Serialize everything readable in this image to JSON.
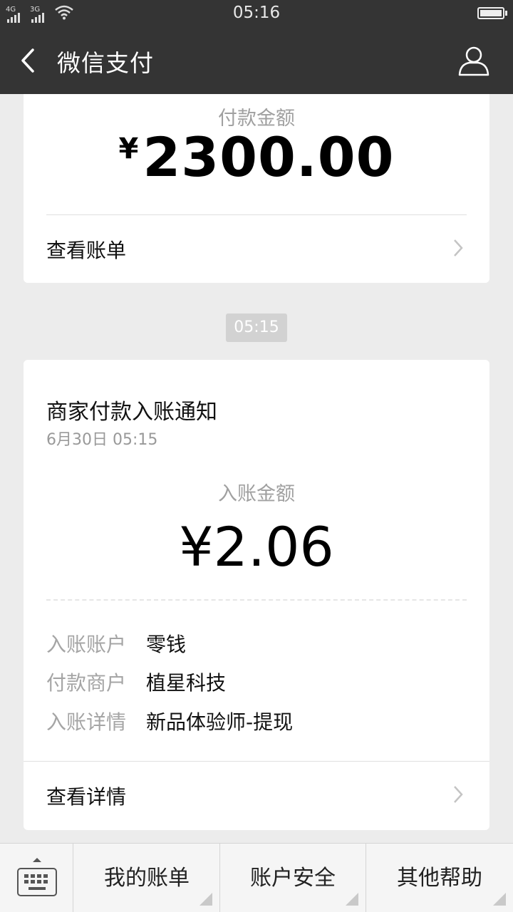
{
  "status_bar": {
    "time": "05:16",
    "network1": "4G",
    "network2": "3G"
  },
  "nav": {
    "title": "微信支付",
    "back_icon": "chevron-left-icon",
    "profile_icon": "person-icon"
  },
  "payment_card": {
    "label": "付款金额",
    "currency": "¥",
    "amount": "2300.00",
    "link_label": "查看账单"
  },
  "time_divider": "05:15",
  "notice_card": {
    "title": "商家付款入账通知",
    "date": "6月30日  05:15",
    "amount_label": "入账金额",
    "amount": "¥2.06",
    "rows": [
      {
        "key": "入账账户",
        "value": "零钱"
      },
      {
        "key": "付款商户",
        "value": "植星科技"
      },
      {
        "key": "入账详情",
        "value": "新品体验师-提现"
      }
    ],
    "link_label": "查看详情"
  },
  "bottom_menu": {
    "keyboard_icon": "keyboard-icon",
    "items": [
      "我的账单",
      "账户安全",
      "其他帮助"
    ]
  },
  "colors": {
    "header_bg": "#343434",
    "page_bg": "#ececec",
    "card_bg": "#ffffff"
  }
}
